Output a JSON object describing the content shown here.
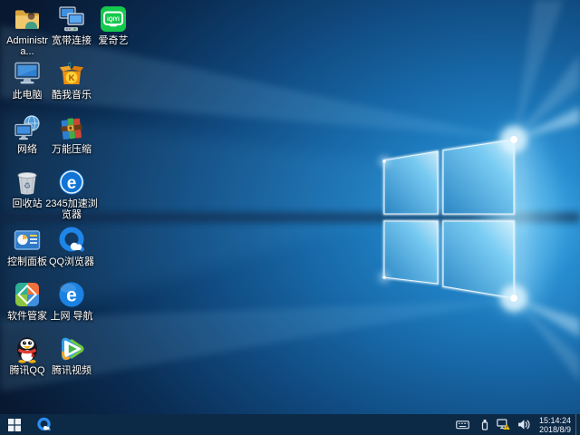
{
  "desktop": {
    "icons": [
      {
        "id": "administrator",
        "label": "Administra..."
      },
      {
        "id": "broadband",
        "label": "宽带连接"
      },
      {
        "id": "iqiyi",
        "label": "爱奇艺",
        "glyph": "iQIYI"
      },
      {
        "id": "this-pc",
        "label": "此电脑"
      },
      {
        "id": "kuwo-music",
        "label": "酷我音乐",
        "glyph": "K",
        "note": "♫"
      },
      {
        "id": "network",
        "label": "网络"
      },
      {
        "id": "archiver",
        "label": "万能压缩"
      },
      {
        "id": "recycle-bin",
        "label": "回收站",
        "glyph": "♻"
      },
      {
        "id": "2345-browser",
        "label": "2345加速浏览器",
        "glyph": "e"
      },
      {
        "id": "control-panel",
        "label": "控制面板"
      },
      {
        "id": "qq-browser",
        "label": "QQ浏览器"
      },
      {
        "id": "software-manager",
        "label": "软件管家"
      },
      {
        "id": "web-nav",
        "label": "上网 导航",
        "glyph": "e"
      },
      {
        "id": "tencent-qq",
        "label": "腾讯QQ"
      },
      {
        "id": "tencent-video",
        "label": "腾讯视频"
      }
    ]
  },
  "taskbar": {
    "pinned": [
      "qq-browser"
    ],
    "tray_icons": [
      "touch-keyboard",
      "usb-device",
      "network-warning",
      "volume"
    ],
    "clock": {
      "time": "15:14:24",
      "date": "2018/8/9"
    }
  },
  "colors": {
    "taskbar": "#0c2946",
    "wallpaper_deep": "#081830",
    "wallpaper_mid": "#1a6dae",
    "wallpaper_glow": "#bfeafe",
    "accent": "#1f86e8"
  }
}
